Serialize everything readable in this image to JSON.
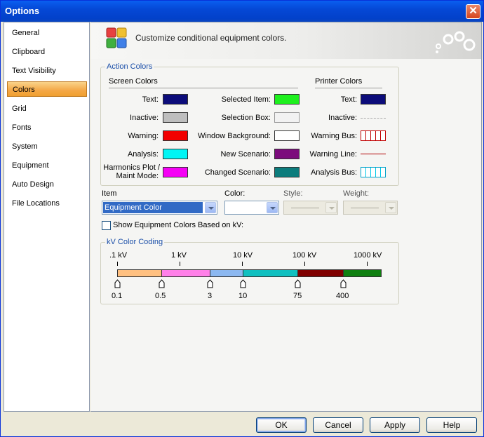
{
  "window": {
    "title": "Options"
  },
  "nav": {
    "items": [
      {
        "label": "General"
      },
      {
        "label": "Clipboard"
      },
      {
        "label": "Text Visibility"
      },
      {
        "label": "Colors",
        "active": true
      },
      {
        "label": "Grid"
      },
      {
        "label": "Fonts"
      },
      {
        "label": "System"
      },
      {
        "label": "Equipment"
      },
      {
        "label": "Auto Design"
      },
      {
        "label": "File Locations"
      }
    ]
  },
  "banner": {
    "text": "Customize conditional equipment colors."
  },
  "action_colors": {
    "title": "Action Colors",
    "screen_header": "Screen Colors",
    "printer_header": "Printer Colors",
    "screen_left": [
      {
        "label": "Text:",
        "color": "#0C0C7A"
      },
      {
        "label": "Inactive:",
        "color": "#BEBEBE"
      },
      {
        "label": "Warning:",
        "color": "#F20000"
      },
      {
        "label": "Analysis:",
        "color": "#00F5F5"
      },
      {
        "label": "Harmonics Plot /",
        "label2": "Maint Mode:",
        "color": "#F500F5"
      }
    ],
    "screen_right": [
      {
        "label": "Selected Item:",
        "color": "#1EF01E"
      },
      {
        "label": "Selection Box:",
        "color": "#F2F2F2"
      },
      {
        "label": "Window Background:",
        "color": "#FFFFFF"
      },
      {
        "label": "New Scenario:",
        "color": "#7C0C7C"
      },
      {
        "label": "Changed Scenario:",
        "color": "#0C7C7C"
      }
    ],
    "printer": [
      {
        "label": "Text:",
        "color": "#0C0C7A"
      },
      {
        "label": "Inactive:",
        "style": "dashed-gray"
      },
      {
        "label": "Warning Bus:",
        "style": "hatched-red"
      },
      {
        "label": "Warning Line:",
        "style": "line-red"
      },
      {
        "label": "Analysis Bus:",
        "style": "hatched-cyan"
      }
    ]
  },
  "item_controls": {
    "item_label": "Item",
    "item_value": "Equipment Color",
    "color_label": "Color:",
    "style_label": "Style:",
    "weight_label": "Weight:"
  },
  "show_kv": {
    "label": "Show Equipment Colors Based on kV:",
    "checked": false
  },
  "kv_coding": {
    "title": "kV Color Coding",
    "scale_labels": [
      ".1 kV",
      "1 kV",
      "10 kV",
      "100 kV",
      "1000 kV"
    ],
    "segments": [
      {
        "color": "#FFC080"
      },
      {
        "color": "#FF80E8"
      },
      {
        "color": "#8CB8F0"
      },
      {
        "color": "#10C0C0"
      },
      {
        "color": "#800000"
      },
      {
        "color": "#108010"
      }
    ],
    "markers": [
      "0.1",
      "0.5",
      "3",
      "10",
      "75",
      "400"
    ]
  },
  "buttons": {
    "ok": "OK",
    "cancel": "Cancel",
    "apply": "Apply",
    "help": "Help"
  }
}
